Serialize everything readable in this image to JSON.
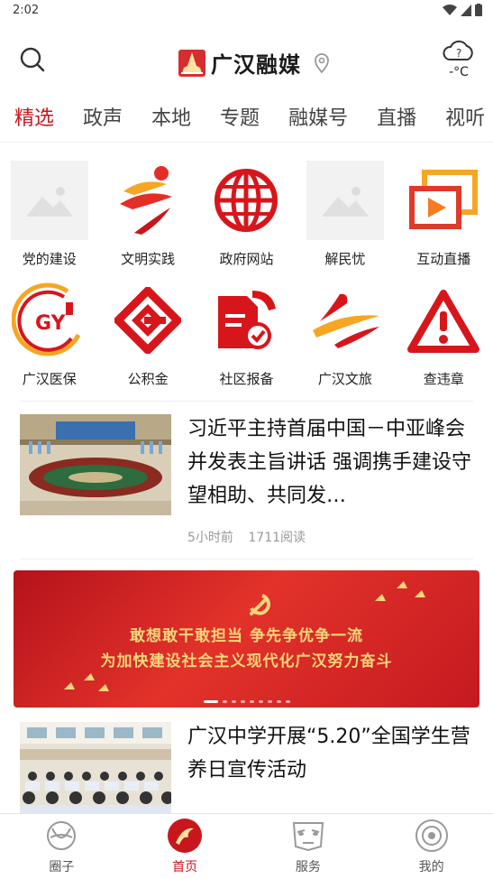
{
  "status_bar": {
    "time": "2:02"
  },
  "header": {
    "app_name": "广汉融媒",
    "temperature": "-°C",
    "search_icon": "search-icon",
    "location_icon": "location-pin-icon",
    "weather_icon": "cloud-unknown-icon"
  },
  "tabs": [
    {
      "label": "精选",
      "active": true
    },
    {
      "label": "政声"
    },
    {
      "label": "本地"
    },
    {
      "label": "专题"
    },
    {
      "label": "融媒号"
    },
    {
      "label": "直播"
    },
    {
      "label": "视听"
    }
  ],
  "services": [
    {
      "label": "党的建设",
      "icon": "image-placeholder-icon"
    },
    {
      "label": "文明实践",
      "icon": "civilization-practice-icon"
    },
    {
      "label": "政府网站",
      "icon": "globe-icon"
    },
    {
      "label": "解民忧",
      "icon": "image-placeholder-icon"
    },
    {
      "label": "互动直播",
      "icon": "live-play-icon"
    },
    {
      "label": "广汉医保",
      "icon": "medical-insurance-icon"
    },
    {
      "label": "公积金",
      "icon": "housing-fund-icon"
    },
    {
      "label": "社区报备",
      "icon": "community-report-icon"
    },
    {
      "label": "广汉文旅",
      "icon": "tourism-icon"
    },
    {
      "label": "查违章",
      "icon": "warning-icon"
    }
  ],
  "news": [
    {
      "title": "习近平主持首届中国－中亚峰会并发表主旨讲话 强调携手建设守望相助、共同发…",
      "time": "5小时前",
      "reads": "1711阅读"
    },
    {
      "title": "广汉中学开展“5.20”全国学生营养日宣传活动"
    }
  ],
  "banner": {
    "line1": "敢想敢干敢担当  争先争优争一流",
    "line2": "为加快建设社会主义现代化广汉努力奋斗",
    "slides": 9,
    "active_slide": 0
  },
  "bottom_nav": [
    {
      "label": "圈子",
      "icon": "circle-community-icon"
    },
    {
      "label": "首页",
      "icon": "home-emblem-icon",
      "active": true
    },
    {
      "label": "服务",
      "icon": "bronze-mask-icon"
    },
    {
      "label": "我的",
      "icon": "profile-icon"
    }
  ],
  "colors": {
    "accent": "#c8161d"
  }
}
